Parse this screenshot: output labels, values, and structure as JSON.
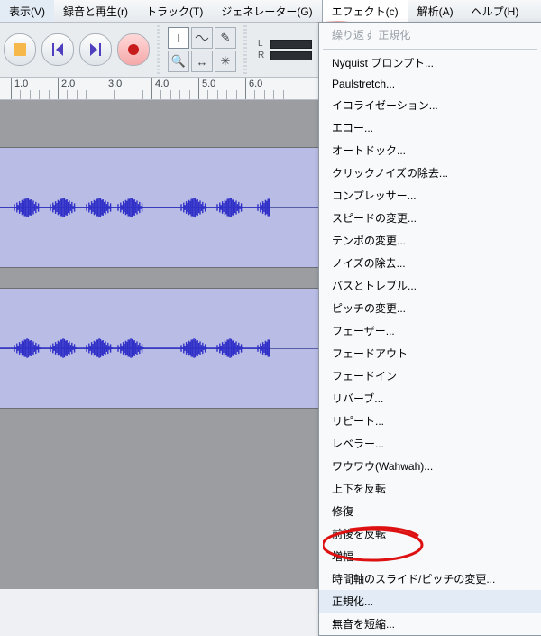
{
  "menubar": {
    "items": [
      {
        "label": "表示(V)"
      },
      {
        "label": "録音と再生(r)"
      },
      {
        "label": "トラック(T)"
      },
      {
        "label": "ジェネレーター(G)"
      },
      {
        "label": "エフェクト(c)"
      },
      {
        "label": "解析(A)"
      },
      {
        "label": "ヘルプ(H)"
      }
    ],
    "open_index": 4
  },
  "dropdown": {
    "disabled_label": "繰り返す 正規化",
    "items": [
      "Nyquist プロンプト...",
      "Paulstretch...",
      "イコライゼーション...",
      "エコー...",
      "オートドック...",
      "クリックノイズの除去...",
      "コンプレッサー...",
      "スピードの変更...",
      "テンポの変更...",
      "ノイズの除去...",
      "バスとトレブル...",
      "ピッチの変更...",
      "フェーザー...",
      "フェードアウト",
      "フェードイン",
      "リバーブ...",
      "リピート...",
      "レベラー...",
      "ワウワウ(Wahwah)...",
      "上下を反転",
      "修復",
      "前後を反転",
      "増幅...",
      "時間軸のスライド/ピッチの変更...",
      "正規化...",
      "無音を短縮..."
    ],
    "highlight_index": 24
  },
  "ruler": {
    "majors": [
      "1.0",
      "2.0",
      "3.0",
      "4.0",
      "5.0",
      "6.0"
    ]
  },
  "meter": {
    "L": "L",
    "R": "R"
  }
}
